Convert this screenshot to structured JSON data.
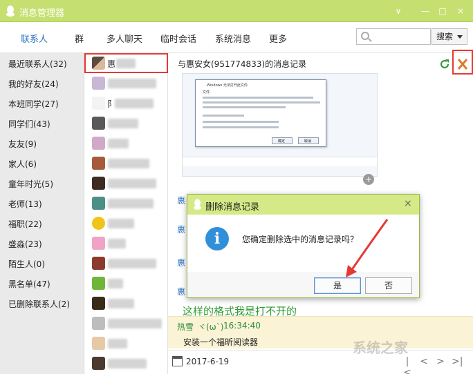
{
  "window": {
    "title": "消息管理器",
    "buttons": [
      "∨",
      "—",
      "□",
      "×"
    ]
  },
  "nav": {
    "tabs": [
      "联系人",
      "群",
      "多人聊天",
      "临时会话",
      "系统消息",
      "更多"
    ],
    "active": "联系人",
    "search_placeholder": "",
    "search_button": "搜索"
  },
  "groups": [
    "最近联系人(32)",
    "我的好友(24)",
    "本班同学(27)",
    "同学们(43)",
    "友友(9)",
    "家人(6)",
    "童年时光(5)",
    "老师(13)",
    "福职(22)",
    "盛淼(23)",
    "陌生人(0)",
    "黑名单(47)",
    "已删除联系人(2)"
  ],
  "contacts": {
    "selected_name": "惠",
    "row7_char": "阝"
  },
  "record": {
    "title": "与惠安女(951774833)的消息记录",
    "side_label": "惠",
    "big_message": "这样的格式我是打不开的",
    "highlight": {
      "sender": "热雪",
      "emoji": "ヾ(ω`)",
      "time": "16:34:40",
      "text": "安装一个福昕阅读器"
    },
    "date": "2017-6-19",
    "pager": [
      "|<",
      "<",
      ">",
      ">|"
    ]
  },
  "screenshot_dialog": {
    "title": "Windows 无法打开此文件:",
    "file_label": "文件:",
    "buttons": [
      "确定",
      "取消"
    ]
  },
  "modal": {
    "title": "删除消息记录",
    "message": "您确定删除选中的消息记录吗？",
    "yes": "是",
    "no": "否"
  },
  "watermark": "系统之家",
  "colors": {
    "titlebar": "#c5e070",
    "accent_green": "#2e9a2e",
    "link_blue": "#2a6fbd",
    "highlight_red": "#e53935"
  }
}
